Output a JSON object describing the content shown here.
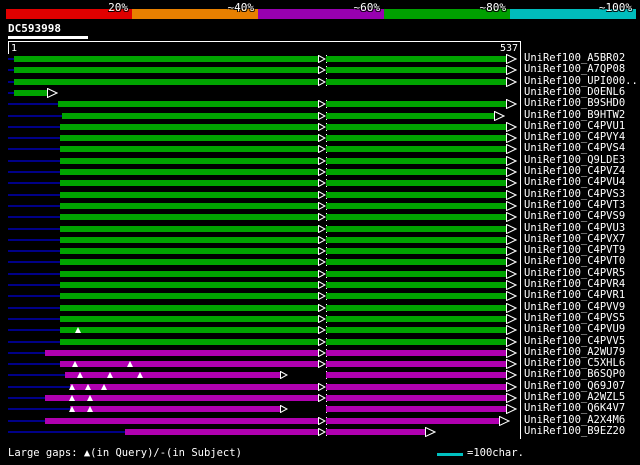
{
  "query": {
    "name": "DC593998",
    "start_label": "1",
    "end_label": "537"
  },
  "color_key": {
    "segments": [
      {
        "label": "20%",
        "color": "#e00000"
      },
      {
        "label": "~40%",
        "color": "#e88000"
      },
      {
        "label": "~60%",
        "color": "#9800b0"
      },
      {
        "label": "~80%",
        "color": "#00a000"
      },
      {
        "label": "~100%",
        "color": "#00bcbc"
      }
    ]
  },
  "legend": {
    "gaps_text": "Large gaps: ▲(in Query)/-(in Subject)",
    "scale_text": "=100char.",
    "scale_color": "#00c0c0"
  },
  "colors": {
    "green": "#00a400",
    "magenta": "#b000b0",
    "lead": "#000088"
  },
  "rows": [
    {
      "label": "UniRef100_A5BR02",
      "tier": "green",
      "segments": [
        [
          6,
          310
        ],
        [
          318,
          499
        ]
      ]
    },
    {
      "label": "UniRef100_A7QP08",
      "tier": "green",
      "segments": [
        [
          6,
          310
        ],
        [
          318,
          499
        ]
      ]
    },
    {
      "label": "UniRef100_UPI000..",
      "tier": "green",
      "segments": [
        [
          6,
          310
        ],
        [
          318,
          499
        ]
      ]
    },
    {
      "label": "UniRef100_D0ENL6",
      "tier": "green",
      "segments": [
        [
          6,
          40
        ]
      ]
    },
    {
      "label": "UniRef100_B9SHD0",
      "tier": "green",
      "segments": [
        [
          50,
          310
        ],
        [
          318,
          499
        ]
      ]
    },
    {
      "label": "UniRef100_B9HTW2",
      "tier": "green",
      "segments": [
        [
          54,
          310
        ],
        [
          318,
          487
        ]
      ]
    },
    {
      "label": "UniRef100_C4PVU1",
      "tier": "green",
      "segments": [
        [
          52,
          310
        ],
        [
          318,
          499
        ]
      ]
    },
    {
      "label": "UniRef100_C4PVY4",
      "tier": "green",
      "segments": [
        [
          52,
          310
        ],
        [
          318,
          499
        ]
      ]
    },
    {
      "label": "UniRef100_C4PVS4",
      "tier": "green",
      "segments": [
        [
          52,
          310
        ],
        [
          318,
          499
        ]
      ]
    },
    {
      "label": "UniRef100_Q9LDE3",
      "tier": "green",
      "segments": [
        [
          52,
          310
        ],
        [
          318,
          499
        ]
      ]
    },
    {
      "label": "UniRef100_C4PVZ4",
      "tier": "green",
      "segments": [
        [
          52,
          310
        ],
        [
          318,
          499
        ]
      ]
    },
    {
      "label": "UniRef100_C4PVU4",
      "tier": "green",
      "segments": [
        [
          52,
          310
        ],
        [
          318,
          499
        ]
      ]
    },
    {
      "label": "UniRef100_C4PVS3",
      "tier": "green",
      "segments": [
        [
          52,
          310
        ],
        [
          318,
          499
        ]
      ]
    },
    {
      "label": "UniRef100_C4PVT3",
      "tier": "green",
      "segments": [
        [
          52,
          310
        ],
        [
          318,
          499
        ]
      ]
    },
    {
      "label": "UniRef100_C4PVS9",
      "tier": "green",
      "segments": [
        [
          52,
          310
        ],
        [
          318,
          499
        ]
      ]
    },
    {
      "label": "UniRef100_C4PVU3",
      "tier": "green",
      "segments": [
        [
          52,
          310
        ],
        [
          318,
          499
        ]
      ]
    },
    {
      "label": "UniRef100_C4PVX7",
      "tier": "green",
      "segments": [
        [
          52,
          310
        ],
        [
          318,
          499
        ]
      ]
    },
    {
      "label": "UniRef100_C4PVT9",
      "tier": "green",
      "segments": [
        [
          52,
          310
        ],
        [
          318,
          499
        ]
      ]
    },
    {
      "label": "UniRef100_C4PVT0",
      "tier": "green",
      "segments": [
        [
          52,
          310
        ],
        [
          318,
          499
        ]
      ]
    },
    {
      "label": "UniRef100_C4PVR5",
      "tier": "green",
      "segments": [
        [
          52,
          310
        ],
        [
          318,
          499
        ]
      ]
    },
    {
      "label": "UniRef100_C4PVR4",
      "tier": "green",
      "segments": [
        [
          52,
          310
        ],
        [
          318,
          499
        ]
      ]
    },
    {
      "label": "UniRef100_C4PVR1",
      "tier": "green",
      "segments": [
        [
          52,
          310
        ],
        [
          318,
          499
        ]
      ]
    },
    {
      "label": "UniRef100_C4PVV9",
      "tier": "green",
      "segments": [
        [
          52,
          310
        ],
        [
          318,
          499
        ]
      ]
    },
    {
      "label": "UniRef100_C4PVS5",
      "tier": "green",
      "segments": [
        [
          52,
          310
        ],
        [
          318,
          499
        ]
      ]
    },
    {
      "label": "UniRef100_C4PVU9",
      "tier": "green",
      "segments": [
        [
          52,
          310
        ],
        [
          318,
          499
        ]
      ],
      "triangles": [
        70
      ]
    },
    {
      "label": "UniRef100_C4PVV5",
      "tier": "green",
      "segments": [
        [
          52,
          310
        ],
        [
          318,
          499
        ]
      ]
    },
    {
      "label": "UniRef100_A2WU79",
      "tier": "magenta",
      "segments": [
        [
          37,
          310
        ],
        [
          318,
          499
        ]
      ]
    },
    {
      "label": "UniRef100_C5XHL6",
      "tier": "magenta",
      "segments": [
        [
          52,
          310
        ],
        [
          318,
          499
        ]
      ],
      "triangles": [
        67,
        122
      ]
    },
    {
      "label": "UniRef100_B6SQP0",
      "tier": "magenta",
      "segments": [
        [
          57,
          272
        ],
        [
          318,
          499
        ]
      ],
      "triangles": [
        72,
        102,
        132
      ]
    },
    {
      "label": "UniRef100_Q69J07",
      "tier": "magenta",
      "segments": [
        [
          62,
          310
        ],
        [
          318,
          499
        ]
      ],
      "triangles": [
        64,
        80,
        96
      ]
    },
    {
      "label": "UniRef100_A2WZL5",
      "tier": "magenta",
      "segments": [
        [
          37,
          310
        ],
        [
          318,
          499
        ]
      ],
      "triangles": [
        64,
        82
      ]
    },
    {
      "label": "UniRef100_Q6K4V7",
      "tier": "magenta",
      "segments": [
        [
          62,
          272
        ],
        [
          318,
          499
        ]
      ],
      "triangles": [
        64,
        82
      ]
    },
    {
      "label": "UniRef100_A2X4M6",
      "tier": "magenta",
      "segments": [
        [
          37,
          310
        ],
        [
          318,
          492
        ]
      ]
    },
    {
      "label": "UniRef100_B9EZ20",
      "tier": "magenta",
      "segments": [
        [
          117,
          310
        ],
        [
          318,
          418
        ]
      ]
    }
  ]
}
